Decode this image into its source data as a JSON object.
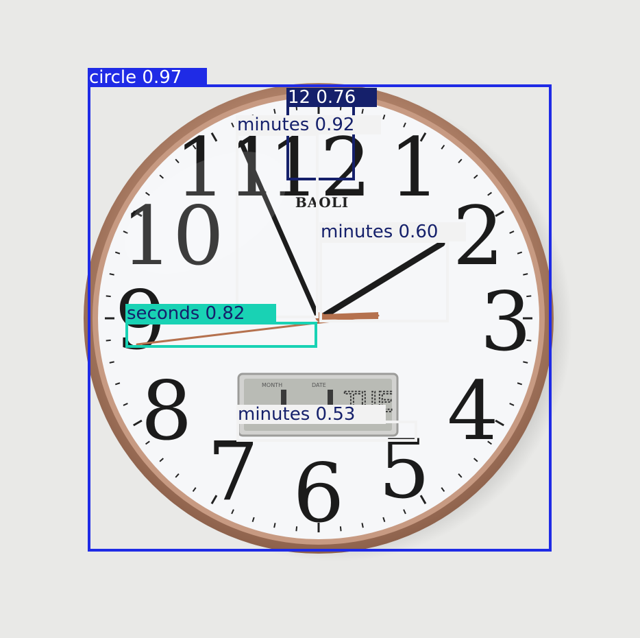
{
  "photo": {
    "brand_text": "BAOLI",
    "dial_numerals": [
      "12",
      "1",
      "2",
      "3",
      "4",
      "5",
      "6",
      "7",
      "8",
      "9",
      "10",
      "11"
    ],
    "lcd": {
      "month_label": "MONTH",
      "date_label": "DATE",
      "day_text": "TUE"
    },
    "colors": {
      "wall": "#e9e9e7",
      "rim": "#b98a70",
      "dial": "#f6f7f9",
      "hands": "#1c1c1c",
      "second_hand": "#b5714e"
    }
  },
  "detections": [
    {
      "label": "circle",
      "score": "0.97",
      "color": "#1f2be6",
      "text_color": "#ffffff"
    },
    {
      "label": "12",
      "score": "0.76",
      "color": "#15206b",
      "text_color": "#ffffff"
    },
    {
      "label": "minutes",
      "score": "0.92",
      "color": "#f2f2f2",
      "text_color": "#15206b"
    },
    {
      "label": "minutes",
      "score": "0.60",
      "color": "#f2f2f2",
      "text_color": "#15206b"
    },
    {
      "label": "seconds",
      "score": "0.82",
      "color": "#19d2b4",
      "text_color": "#15206b"
    },
    {
      "label": "minutes",
      "score": "0.53",
      "color": "#f2f2f2",
      "text_color": "#15206b"
    }
  ]
}
